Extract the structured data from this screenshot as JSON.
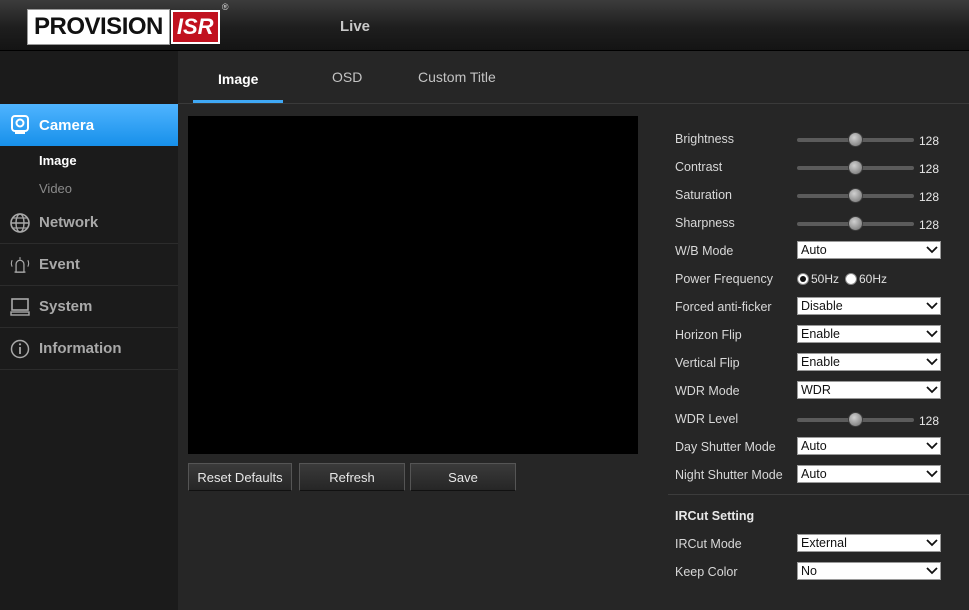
{
  "header": {
    "logo_text": "PROVISION",
    "logo_isr": "ISR",
    "logo_reg": "®",
    "live_label": "Live"
  },
  "sidebar": {
    "items": [
      {
        "label": "Camera",
        "icon": "camera-icon"
      },
      {
        "label": "Network",
        "icon": "network-icon"
      },
      {
        "label": "Event",
        "icon": "alarm-icon"
      },
      {
        "label": "System",
        "icon": "monitor-icon"
      },
      {
        "label": "Information",
        "icon": "info-icon"
      }
    ],
    "sub_items": [
      {
        "label": "Image"
      },
      {
        "label": "Video"
      }
    ]
  },
  "tabs": [
    {
      "label": "Image"
    },
    {
      "label": "OSD"
    },
    {
      "label": "Custom Title"
    }
  ],
  "buttons": {
    "reset": "Reset Defaults",
    "refresh": "Refresh",
    "save": "Save"
  },
  "settings": {
    "brightness": {
      "label": "Brightness",
      "value": "128",
      "fraction": 0.5
    },
    "contrast": {
      "label": "Contrast",
      "value": "128",
      "fraction": 0.5
    },
    "saturation": {
      "label": "Saturation",
      "value": "128",
      "fraction": 0.5
    },
    "sharpness": {
      "label": "Sharpness",
      "value": "128",
      "fraction": 0.5
    },
    "wb_mode": {
      "label": "W/B Mode",
      "value": "Auto"
    },
    "power_frequency": {
      "label": "Power Frequency",
      "options": [
        "50Hz",
        "60Hz"
      ],
      "selected": "50Hz"
    },
    "forced_antiflicker": {
      "label": "Forced anti-ficker",
      "value": "Disable"
    },
    "horizon_flip": {
      "label": "Horizon Flip",
      "value": "Enable"
    },
    "vertical_flip": {
      "label": "Vertical Flip",
      "value": "Enable"
    },
    "wdr_mode": {
      "label": "WDR Mode",
      "value": "WDR"
    },
    "wdr_level": {
      "label": "WDR Level",
      "value": "128",
      "fraction": 0.5
    },
    "day_shutter": {
      "label": "Day Shutter Mode",
      "value": "Auto"
    },
    "night_shutter": {
      "label": "Night Shutter Mode",
      "value": "Auto"
    }
  },
  "ircut": {
    "heading": "IRCut Setting",
    "mode": {
      "label": "IRCut Mode",
      "value": "External"
    },
    "keep_color": {
      "label": "Keep Color",
      "value": "No"
    }
  },
  "colors": {
    "accent": "#3fa8f5",
    "active_nav": "#1e95ec",
    "logo_red": "#c1121f"
  }
}
